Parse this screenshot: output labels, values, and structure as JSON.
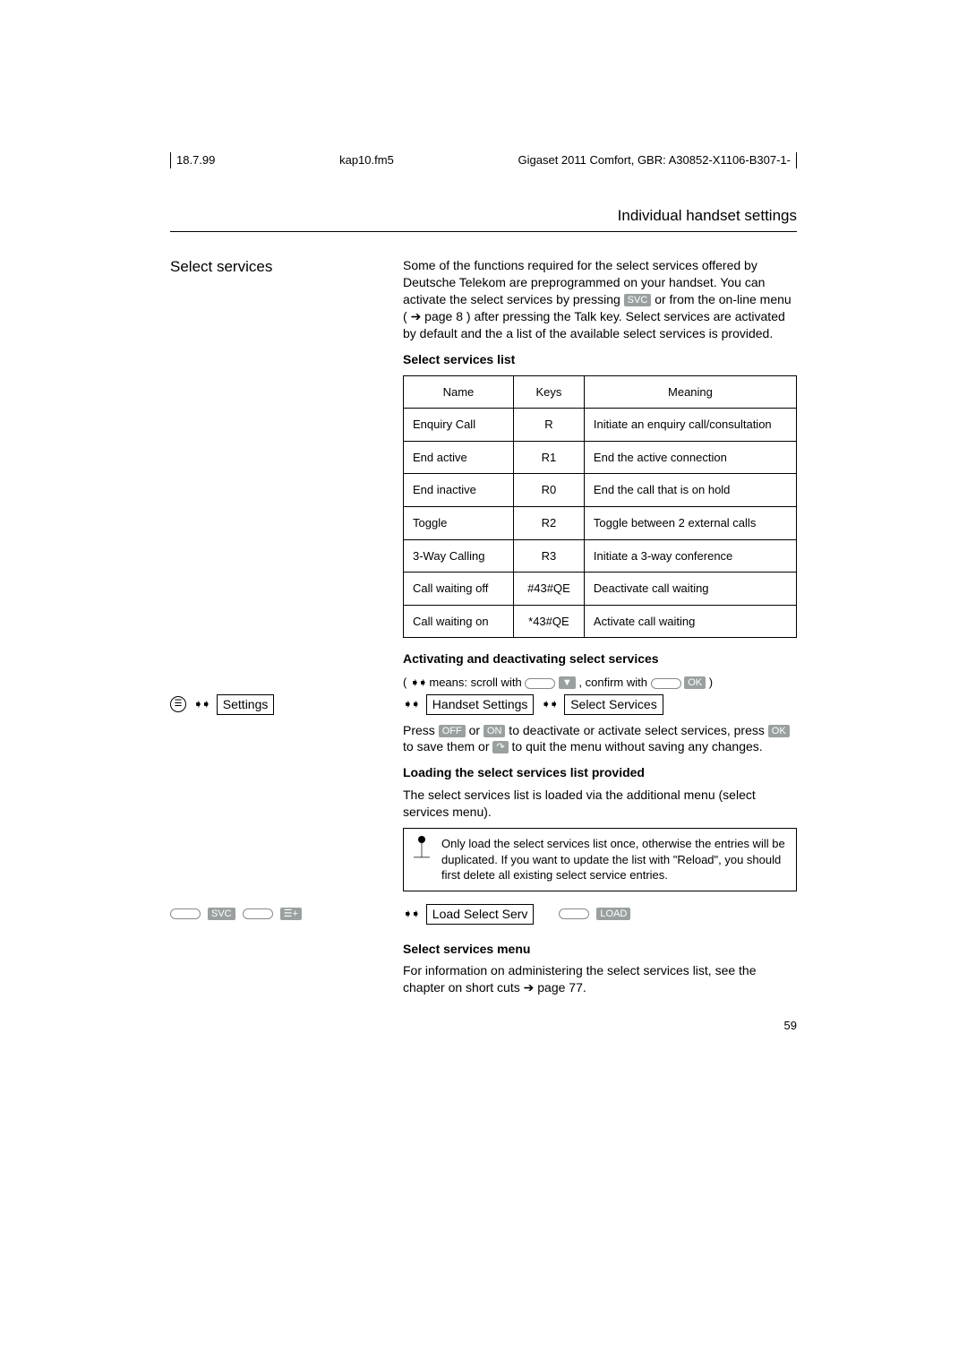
{
  "header": {
    "date": "18.7.99",
    "file": "kap10.fm5",
    "product": "Gigaset 2011 Comfort, GBR: A30852-X1106-B307-1-"
  },
  "page_title": "Individual handset settings",
  "section_title": "Select services",
  "intro": {
    "p1a": "Some of the functions required for the select services offered by Deutsche Telekom are preprogrammed on your handset. You can activate the select services by pressing ",
    "svc_badge": "SVC",
    "p1b": " or from the on-line menu ( ",
    "arrow": "➔",
    "page_ref": " page 8 ) after pressing the Talk key. Select services are activated by default and the a list of the available select services is provided."
  },
  "table_heading": "Select services list",
  "table": {
    "cols": [
      "Name",
      "Keys",
      "Meaning"
    ],
    "rows": [
      [
        "Enquiry Call",
        "R",
        "Initiate an enquiry call/consultation"
      ],
      [
        "End active",
        "R1",
        "End the active connection"
      ],
      [
        "End inactive",
        "R0",
        "End the call that is on hold"
      ],
      [
        "Toggle",
        "R2",
        "Toggle between 2 external calls"
      ],
      [
        "3-Way Calling",
        "R3",
        "Initiate a 3-way conference"
      ],
      [
        "Call waiting off",
        "#43#QE",
        "Deactivate call waiting"
      ],
      [
        "Call waiting on",
        "*43#QE",
        "Activate call waiting"
      ]
    ]
  },
  "activating_heading": "Activating and deactivating select services",
  "hint": {
    "pre": "( ",
    "arrow": "➧➧",
    "text1": " means: scroll with ",
    "down_badge": "▼",
    "text2": " , confirm with ",
    "ok_badge": "OK",
    "post": " )"
  },
  "nav1": {
    "settings": "Settings",
    "handset": "Handset Settings",
    "select": "Select Services"
  },
  "press_line": {
    "a": "Press ",
    "off": "OFF",
    "b": " or ",
    "on": "ON",
    "c": " to deactivate or activate select services, press ",
    "ok": "OK",
    "d": " to save them or ",
    "esc": "↷",
    "e": " to quit the menu without saving any changes."
  },
  "loading_heading": "Loading the select services list provided",
  "loading_text": "The select services list is loaded via the additional menu (select services menu).",
  "note_text": "Only load the select services list once, otherwise the entries will be duplicated. If you want to update the list with \"Reload\", you should first delete all existing select service entries.",
  "nav2": {
    "svc": "SVC",
    "menuplus_alt": "menu-plus",
    "load": "Load Select Serv",
    "load_badge": "LOAD"
  },
  "menu_heading": "Select services menu",
  "menu_text": {
    "a": "For information on administering the select services list, see the chapter on short cuts ",
    "arrow": "➔",
    "b": " page 77."
  },
  "page_number": "59"
}
